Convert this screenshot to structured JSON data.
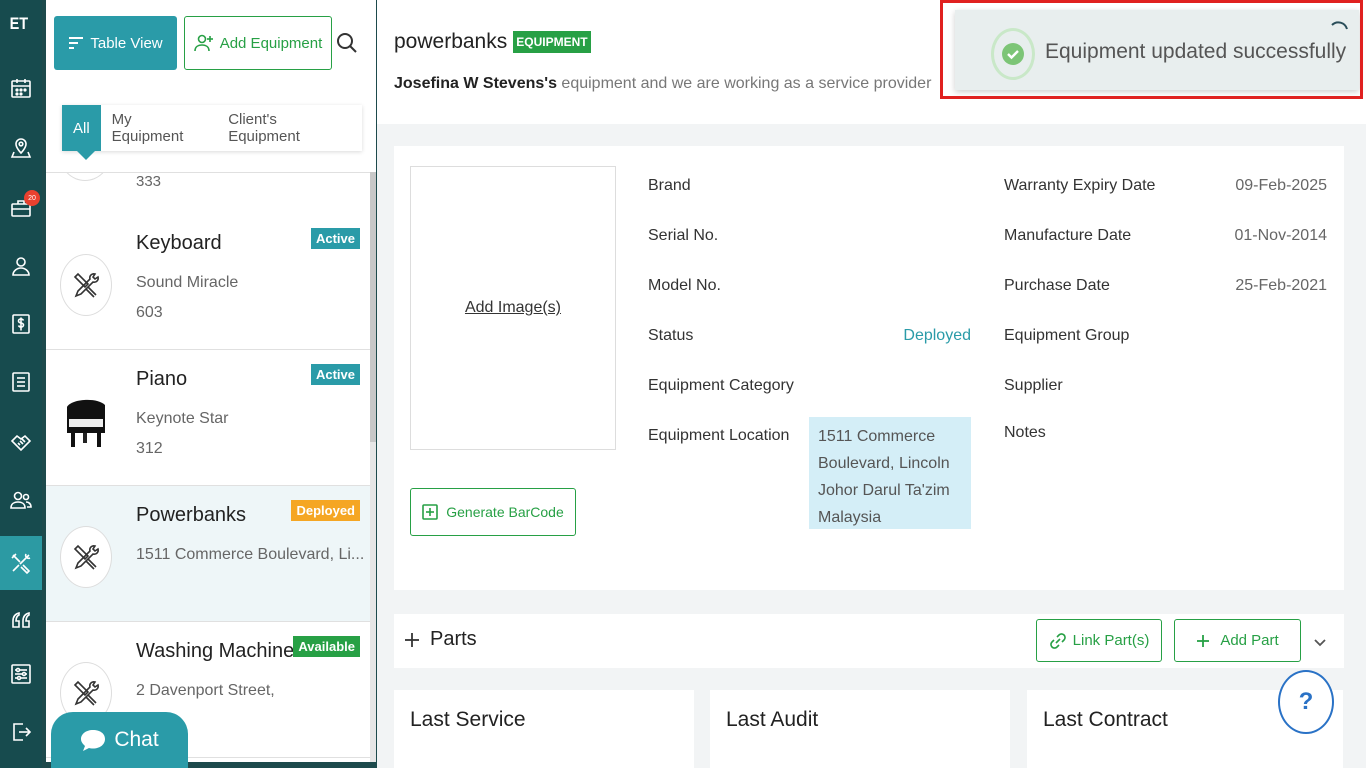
{
  "app": {
    "logo": "ET",
    "nav_badge": "20"
  },
  "toolbar": {
    "table_view": "Table View",
    "add_equipment": "Add Equipment"
  },
  "filters": {
    "all": "All",
    "mine": "My Equipment",
    "clients": "Client's Equipment"
  },
  "list": {
    "peek_text": "333",
    "items": [
      {
        "name": "Keyboard",
        "line1": "Sound Miracle",
        "line2": "603",
        "status": "Active"
      },
      {
        "name": "Piano",
        "line1": "Keynote Star",
        "line2": "312",
        "status": "Active"
      },
      {
        "name": "Powerbanks",
        "line1": "1511 Commerce Boulevard, Li...",
        "line2": "",
        "status": "Deployed"
      },
      {
        "name": "Washing Machine",
        "line1": "2 Davenport Street,",
        "line2": "",
        "status": "Available"
      }
    ]
  },
  "chat": {
    "label": "Chat"
  },
  "header": {
    "title": "powerbanks",
    "tag": "EQUIPMENT",
    "owner": "Josefina W Stevens's",
    "subtitle_rest": " equipment and we are working as a service provider"
  },
  "detail": {
    "add_image": "Add Image(s)",
    "generate_barcode": "Generate BarCode",
    "brand_label": "Brand",
    "serial_label": "Serial No.",
    "model_label": "Model No.",
    "status_label": "Status",
    "status_value": "Deployed",
    "category_label": "Equipment Category",
    "location_label": "Equipment Location",
    "location_lines": [
      "1511 Commerce",
      "Boulevard, Lincoln",
      "Johor Darul Ta'zim",
      "Malaysia"
    ],
    "warranty_label": "Warranty Expiry Date",
    "warranty_value": "09-Feb-2025",
    "manufacture_label": "Manufacture Date",
    "manufacture_value": "01-Nov-2014",
    "purchase_label": "Purchase Date",
    "purchase_value": "25-Feb-2021",
    "group_label": "Equipment Group",
    "supplier_label": "Supplier",
    "notes_label": "Notes"
  },
  "parts": {
    "title": "Parts",
    "link": "Link Part(s)",
    "add": "Add Part"
  },
  "cards": {
    "service": "Last Service",
    "audit": "Last Audit",
    "contract": "Last Contract"
  },
  "help": {
    "label": "?"
  },
  "toast": {
    "message": "Equipment updated successfully"
  },
  "colors": {
    "teal": "#2a9ba8",
    "green": "#27a045",
    "orange": "#f5a623",
    "nav": "#174b4e",
    "highlight": "#e0201f"
  }
}
